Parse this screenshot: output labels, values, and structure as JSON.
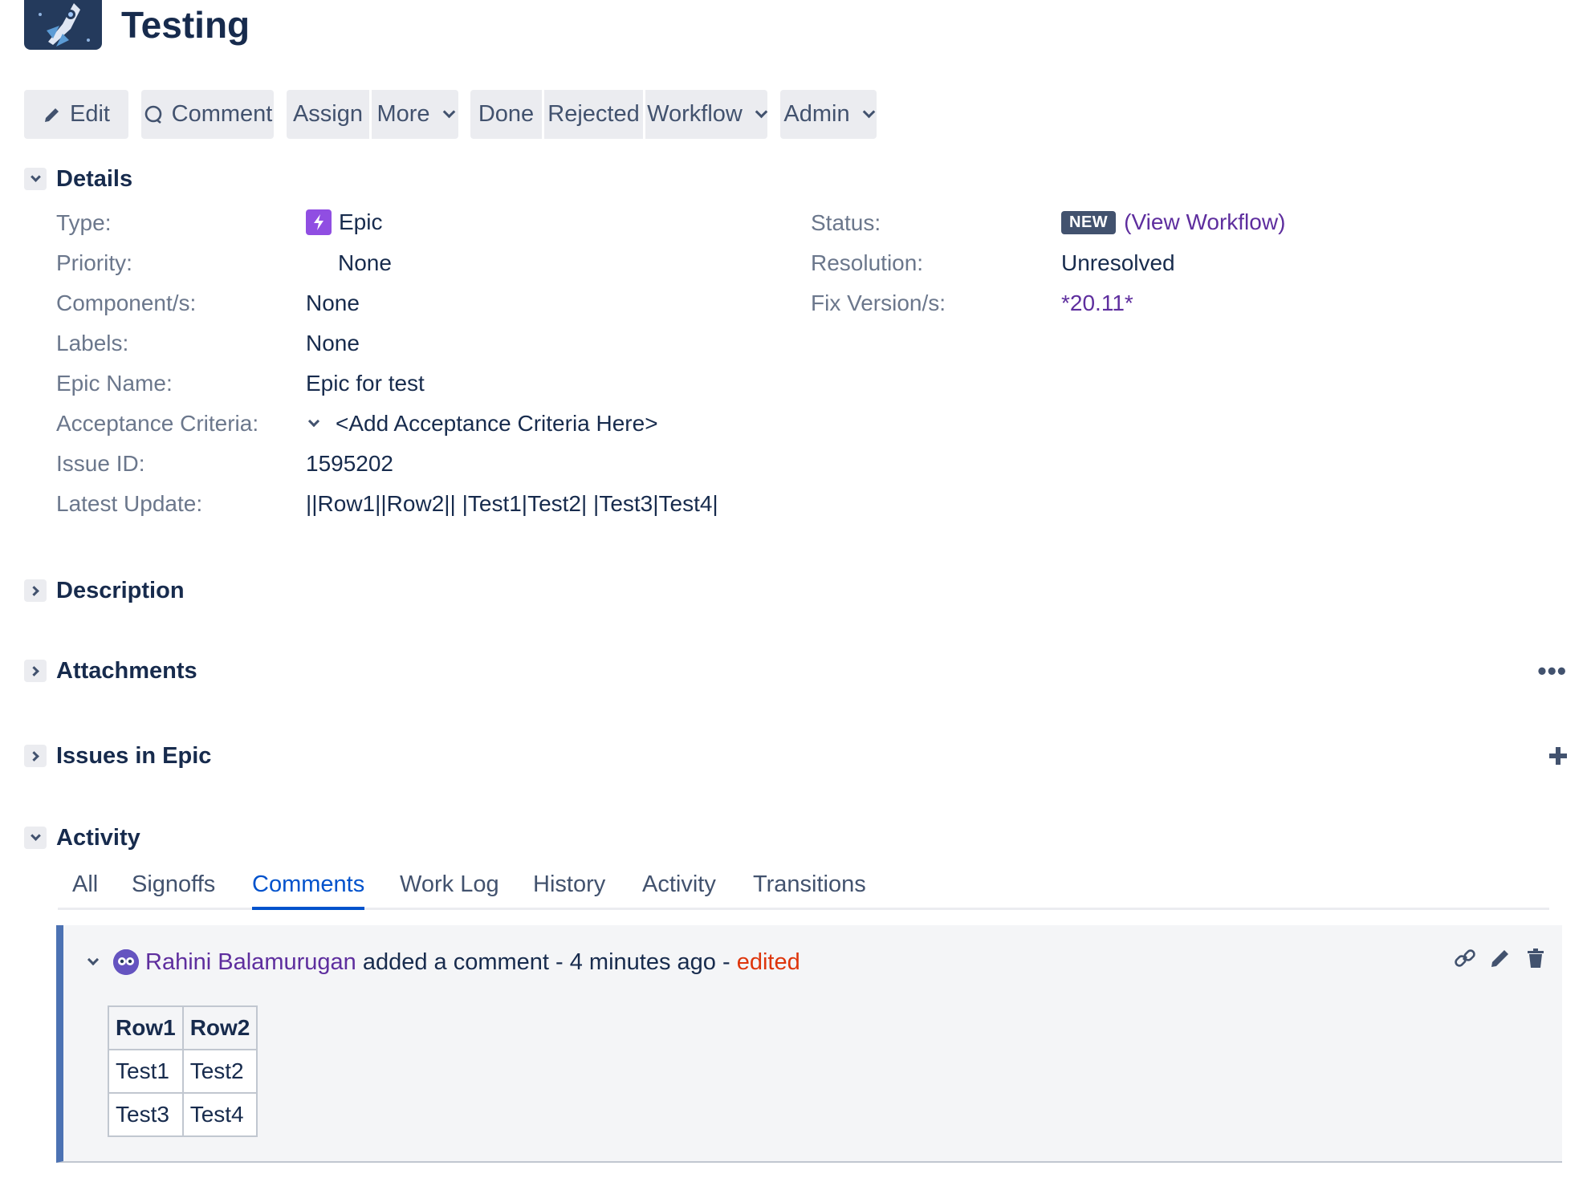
{
  "header": {
    "title": "Testing",
    "logo_icon": "rocket-project-avatar"
  },
  "toolbar": {
    "edit": "Edit",
    "comment": "Comment",
    "assign": "Assign",
    "more": "More",
    "done": "Done",
    "rejected": "Rejected",
    "workflow": "Workflow",
    "admin": "Admin"
  },
  "details": {
    "title": "Details",
    "left": [
      {
        "label": "Type:",
        "value": "Epic"
      },
      {
        "label": "Priority:",
        "value": "None"
      },
      {
        "label": "Component/s:",
        "value": "None"
      },
      {
        "label": "Labels:",
        "value": "None"
      },
      {
        "label": "Epic Name:",
        "value": "Epic for test"
      },
      {
        "label": "Acceptance Criteria:",
        "value": "<Add Acceptance Criteria Here>"
      },
      {
        "label": "Issue ID:",
        "value": "1595202"
      },
      {
        "label": "Latest Update:",
        "value": "||Row1||Row2|| |Test1|Test2| |Test3|Test4|"
      }
    ],
    "right": [
      {
        "label": "Status:",
        "lozenge": "NEW",
        "value": "(View Workflow)"
      },
      {
        "label": "Resolution:",
        "value": "Unresolved"
      },
      {
        "label": "Fix Version/s:",
        "value": "*20.11*"
      }
    ]
  },
  "sections": {
    "description": "Description",
    "attachments": "Attachments",
    "issues_in_epic": "Issues in Epic",
    "activity": "Activity",
    "more_dots": "•••"
  },
  "activity": {
    "tabs": [
      "All",
      "Signoffs",
      "Comments",
      "Work Log",
      "History",
      "Activity",
      "Transitions"
    ],
    "active_tab": "Comments",
    "comment": {
      "author": "Rahini Balamurugan",
      "action": " added a comment - 4 minutes ago - ",
      "edited": "edited",
      "table": {
        "headers": [
          "Row1",
          "Row2"
        ],
        "rows": [
          [
            "Test1",
            "Test2"
          ],
          [
            "Test3",
            "Test4"
          ]
        ]
      }
    }
  },
  "colors": {
    "link": "#5e2e9e",
    "active_tab": "#0052cc",
    "edited": "#de350b",
    "comment_border": "#4c72b3",
    "epic_icon": "#904ee2",
    "lozenge": "#42526e"
  }
}
